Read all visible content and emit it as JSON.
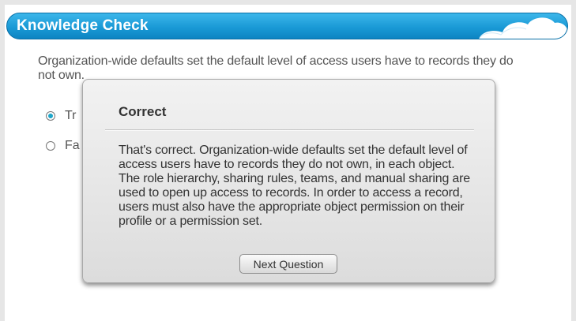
{
  "header": {
    "title": "Knowledge Check",
    "decoration_icon": "cloud-icon"
  },
  "question": {
    "text": "Organization-wide defaults set the default level of access users have to records they do not own.",
    "options": [
      {
        "label": "True",
        "visible_text": "Tr",
        "selected": true
      },
      {
        "label": "False",
        "visible_text": "Fa",
        "selected": false
      }
    ]
  },
  "feedback": {
    "title": "Correct",
    "body": "That's correct. Organization-wide defaults set the default level of access users have to records they do not own, in each object. The role hierarchy, sharing rules, teams, and manual sharing are used to open up access to records. In order to access a record, users must also have the appropriate object permission on their profile or a permission set.",
    "next_label": "Next Question"
  },
  "colors": {
    "header_blue": "#1a9ad6",
    "radio_selected": "#1fa6c9"
  }
}
